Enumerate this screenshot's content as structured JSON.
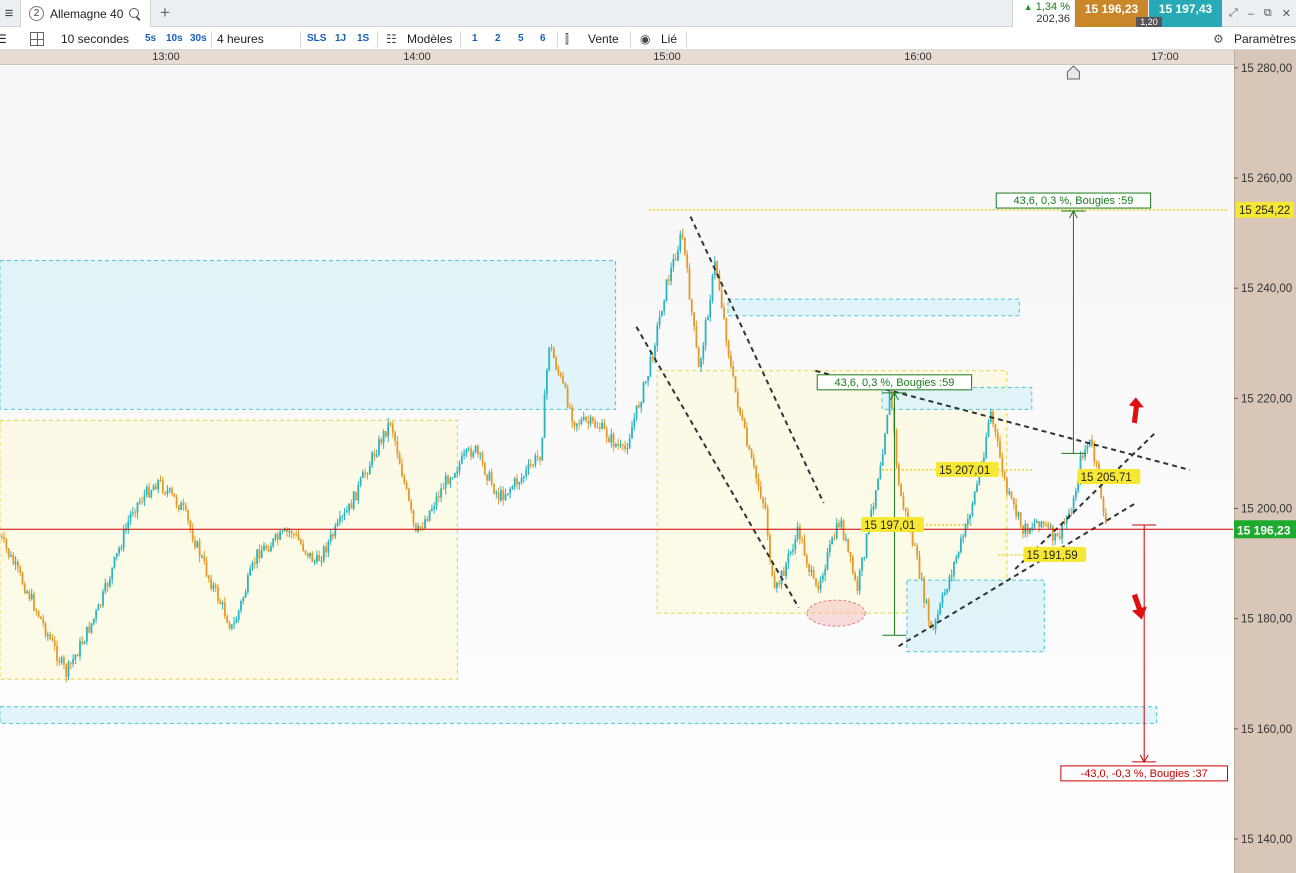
{
  "header": {
    "tab_number": "2",
    "instrument": "Allemagne 40",
    "add_tab": "+",
    "change_pct": "1,34 %",
    "change_pts": "202,36",
    "bid": "15 196,23",
    "ask": "15 197,43",
    "spread": "1,20"
  },
  "toolbar": {
    "interval": "10 secondes",
    "quick_intervals": [
      "5s",
      "10s",
      "30s"
    ],
    "duration": "4 heures",
    "periods": [
      "SLS",
      "1J",
      "1S"
    ],
    "templates_label": "Modèles",
    "templates": [
      "1",
      "2",
      "5",
      "6"
    ],
    "sell_label": "Vente",
    "linked_label": "Lié",
    "settings_label": "Paramètres"
  },
  "colors": {
    "up": "#2bb3c0",
    "down": "#e39a2a",
    "current_price_line": "#cc0000",
    "zone_blue": "#dff4f9",
    "zone_yellow": "#fdfbe6",
    "annotation_green": "#1a7a1a",
    "annotation_red": "#cc0000",
    "label_yellow": "#f6e832",
    "current_price_badge": "#1eaa2e"
  },
  "chart_data": {
    "type": "candlestick",
    "instrument": "Allemagne 40",
    "timeframe": "10 secondes",
    "x_ticks": [
      "13:00",
      "14:00",
      "15:00",
      "16:00",
      "17:00"
    ],
    "x_range": [
      "12:20",
      "17:15"
    ],
    "y_ticks": [
      "15 140,00",
      "15 160,00",
      "15 180,00",
      "15 200,00",
      "15 220,00",
      "15 240,00",
      "15 260,00",
      "15 280,00"
    ],
    "ylim": [
      15134,
      15283
    ],
    "current_price": 15196.23,
    "current_price_label": "15 196,23",
    "high_level": 15254.22,
    "high_level_label": "15 254,22",
    "price_path": [
      [
        "12:20",
        15195
      ],
      [
        "12:28",
        15183
      ],
      [
        "12:36",
        15170
      ],
      [
        "12:44",
        15182
      ],
      [
        "12:52",
        15200
      ],
      [
        "12:58",
        15205
      ],
      [
        "13:04",
        15200
      ],
      [
        "13:10",
        15188
      ],
      [
        "13:16",
        15178
      ],
      [
        "13:22",
        15192
      ],
      [
        "13:30",
        15196
      ],
      [
        "13:36",
        15190
      ],
      [
        "13:44",
        15200
      ],
      [
        "13:50",
        15210
      ],
      [
        "13:54",
        15216
      ],
      [
        "14:00",
        15195
      ],
      [
        "14:08",
        15206
      ],
      [
        "14:14",
        15211
      ],
      [
        "14:20",
        15202
      ],
      [
        "14:26",
        15206
      ],
      [
        "14:30",
        15210
      ],
      [
        "14:32",
        15230
      ],
      [
        "14:38",
        15216
      ],
      [
        "14:44",
        15215
      ],
      [
        "14:50",
        15210
      ],
      [
        "14:56",
        15225
      ],
      [
        "15:00",
        15240
      ],
      [
        "15:04",
        15250
      ],
      [
        "15:08",
        15225
      ],
      [
        "15:12",
        15245
      ],
      [
        "15:16",
        15224
      ],
      [
        "15:20",
        15210
      ],
      [
        "15:24",
        15200
      ],
      [
        "15:26",
        15184
      ],
      [
        "15:32",
        15196
      ],
      [
        "15:36",
        15185
      ],
      [
        "15:42",
        15198
      ],
      [
        "15:46",
        15185
      ],
      [
        "15:52",
        15210
      ],
      [
        "15:54",
        15222
      ],
      [
        "15:56",
        15204
      ],
      [
        "16:00",
        15192
      ],
      [
        "16:04",
        15177
      ],
      [
        "16:08",
        15187
      ],
      [
        "16:12",
        15196
      ],
      [
        "16:16",
        15208
      ],
      [
        "16:18",
        15218
      ],
      [
        "16:22",
        15203
      ],
      [
        "16:26",
        15196
      ],
      [
        "16:30",
        15198
      ],
      [
        "16:34",
        15194
      ],
      [
        "16:38",
        15201
      ],
      [
        "16:40",
        15210
      ],
      [
        "16:42",
        15212
      ],
      [
        "16:44",
        15206
      ],
      [
        "16:46",
        15196
      ]
    ],
    "zones": [
      {
        "color": "blue",
        "time": [
          "12:20",
          "14:48"
        ],
        "price": [
          15218,
          15245
        ]
      },
      {
        "color": "yellow",
        "time": [
          "12:20",
          "14:10"
        ],
        "price": [
          15169,
          15216
        ]
      },
      {
        "color": "yellow",
        "time": [
          "14:58",
          "16:22"
        ],
        "price": [
          15181,
          15225
        ]
      },
      {
        "color": "blue",
        "time": [
          "15:15",
          "16:25"
        ],
        "price": [
          15235,
          15238
        ]
      },
      {
        "color": "blue",
        "time": [
          "15:52",
          "16:28"
        ],
        "price": [
          15218,
          15222
        ]
      },
      {
        "color": "blue",
        "time": [
          "15:58",
          "16:31"
        ],
        "price": [
          15174,
          15187
        ]
      },
      {
        "color": "blue",
        "time": [
          "12:20",
          "16:58"
        ],
        "price": [
          15161,
          15164
        ]
      }
    ],
    "levels": [
      {
        "price": 15254.22,
        "time": [
          "14:56",
          "17:15"
        ],
        "color": "#f0d020"
      },
      {
        "price": 15207.01,
        "time": [
          "15:52",
          "16:28"
        ],
        "color": "#f0d020"
      },
      {
        "price": 15197.01,
        "time": [
          "15:52",
          "16:14"
        ],
        "color": "#f0d020"
      },
      {
        "price": 15191.59,
        "time": [
          "16:20",
          "16:40"
        ],
        "color": "#f0d020"
      }
    ],
    "trendlines": [
      {
        "from": [
          "14:53",
          15233
        ],
        "to": [
          "15:32",
          15182
        ]
      },
      {
        "from": [
          "15:06",
          15253
        ],
        "to": [
          "15:38",
          15201
        ]
      },
      {
        "from": [
          "15:36",
          15225
        ],
        "to": [
          "17:06",
          15207
        ]
      },
      {
        "from": [
          "15:56",
          15175
        ],
        "to": [
          "16:53",
          15201
        ]
      },
      {
        "from": [
          "16:24",
          15189
        ],
        "to": [
          "16:58",
          15214
        ]
      }
    ],
    "measures": [
      {
        "label": "43,6, 0,3 %, Bougies :59",
        "color": "green",
        "from": [
          "16:38",
          15210
        ],
        "to": [
          "16:38",
          15254
        ]
      },
      {
        "label": "43,6, 0,3 %, Bougies :59",
        "color": "green",
        "from": [
          "15:55",
          15177
        ],
        "to": [
          "15:55",
          15221
        ]
      },
      {
        "label": "-43,0, -0,3 %, Bougies :37",
        "color": "red",
        "from": [
          "16:55",
          15197
        ],
        "to": [
          "16:55",
          15154
        ]
      }
    ],
    "price_labels": [
      {
        "text": "15 207,01",
        "time": "16:05",
        "price": 15207.01
      },
      {
        "text": "15 197,01",
        "time": "15:47",
        "price": 15197.01
      },
      {
        "text": "15 191,59",
        "time": "16:26",
        "price": 15191.59
      },
      {
        "text": "15 205,71",
        "time": "16:39",
        "price": 15205.71
      }
    ],
    "arrows": [
      {
        "direction": "up",
        "time": "16:53",
        "price": 15218
      },
      {
        "direction": "down",
        "time": "16:53",
        "price": 15182
      }
    ],
    "highlight_ellipse": {
      "time": [
        "15:34",
        "15:48"
      ],
      "price": [
        15180,
        15182
      ]
    },
    "scroll_marker_time": "16:38"
  }
}
